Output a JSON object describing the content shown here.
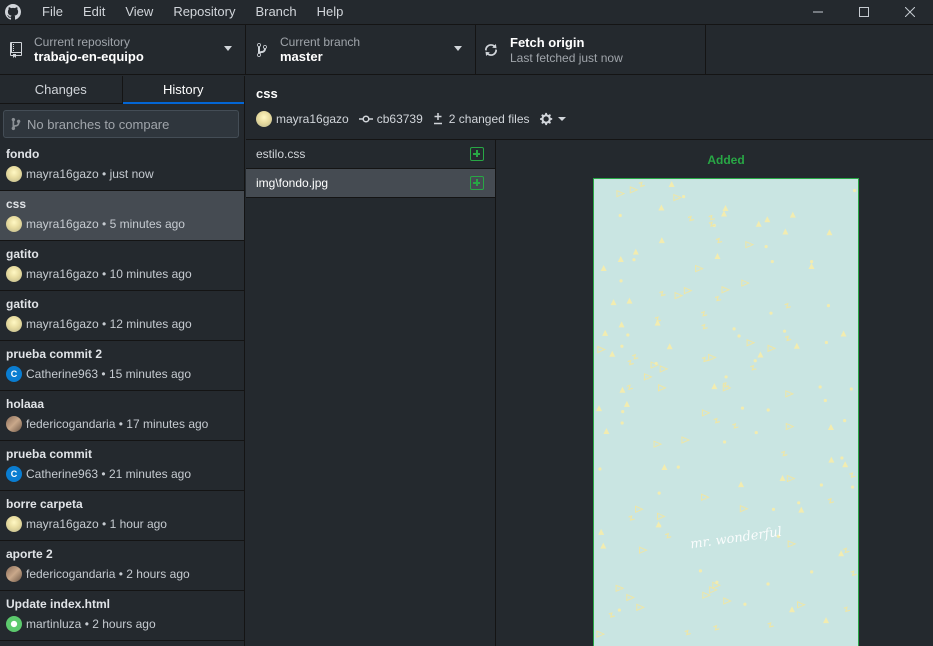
{
  "menu": [
    "File",
    "Edit",
    "View",
    "Repository",
    "Branch",
    "Help"
  ],
  "toolbar": {
    "repo_label": "Current repository",
    "repo_name": "trabajo-en-equipo",
    "branch_label": "Current branch",
    "branch_name": "master",
    "fetch_title": "Fetch origin",
    "fetch_sub": "Last fetched just now"
  },
  "sidebar": {
    "tabs": [
      "Changes",
      "History"
    ],
    "active_tab": "History",
    "compare_placeholder": "No branches to compare",
    "commits": [
      {
        "title": "fondo",
        "author": "mayra16gazo",
        "time": "just now",
        "avatar": "yellow"
      },
      {
        "title": "css",
        "author": "mayra16gazo",
        "time": "5 minutes ago",
        "avatar": "yellow",
        "selected": true
      },
      {
        "title": "gatito",
        "author": "mayra16gazo",
        "time": "10 minutes ago",
        "avatar": "yellow"
      },
      {
        "title": "gatito",
        "author": "mayra16gazo",
        "time": "12 minutes ago",
        "avatar": "yellow"
      },
      {
        "title": "prueba commit 2",
        "author": "Catherine963",
        "time": "15 minutes ago",
        "avatar": "blue",
        "initial": "C"
      },
      {
        "title": "holaaa",
        "author": "federicogandaria",
        "time": "17 minutes ago",
        "avatar": "photo"
      },
      {
        "title": "prueba commit",
        "author": "Catherine963",
        "time": "21 minutes ago",
        "avatar": "blue",
        "initial": "C"
      },
      {
        "title": "borre carpeta",
        "author": "mayra16gazo",
        "time": "1 hour ago",
        "avatar": "yellow"
      },
      {
        "title": "aporte 2",
        "author": "federicogandaria",
        "time": "2 hours ago",
        "avatar": "photo"
      },
      {
        "title": "Update index.html",
        "author": "martinluza",
        "time": "2 hours ago",
        "avatar": "green"
      }
    ]
  },
  "commit": {
    "title": "css",
    "author": "mayra16gazo",
    "sha": "cb63739",
    "changed_files": "2 changed files"
  },
  "files": [
    {
      "name": "estilo.css",
      "status": "added"
    },
    {
      "name": "img\\fondo.jpg",
      "status": "added",
      "selected": true
    }
  ],
  "diff": {
    "status_label": "Added",
    "image_watermark": "mr. wonderful"
  },
  "colors": {
    "added": "#28a745",
    "accent": "#0366d6",
    "selected_row": "#454b52",
    "background": "#24292e"
  }
}
